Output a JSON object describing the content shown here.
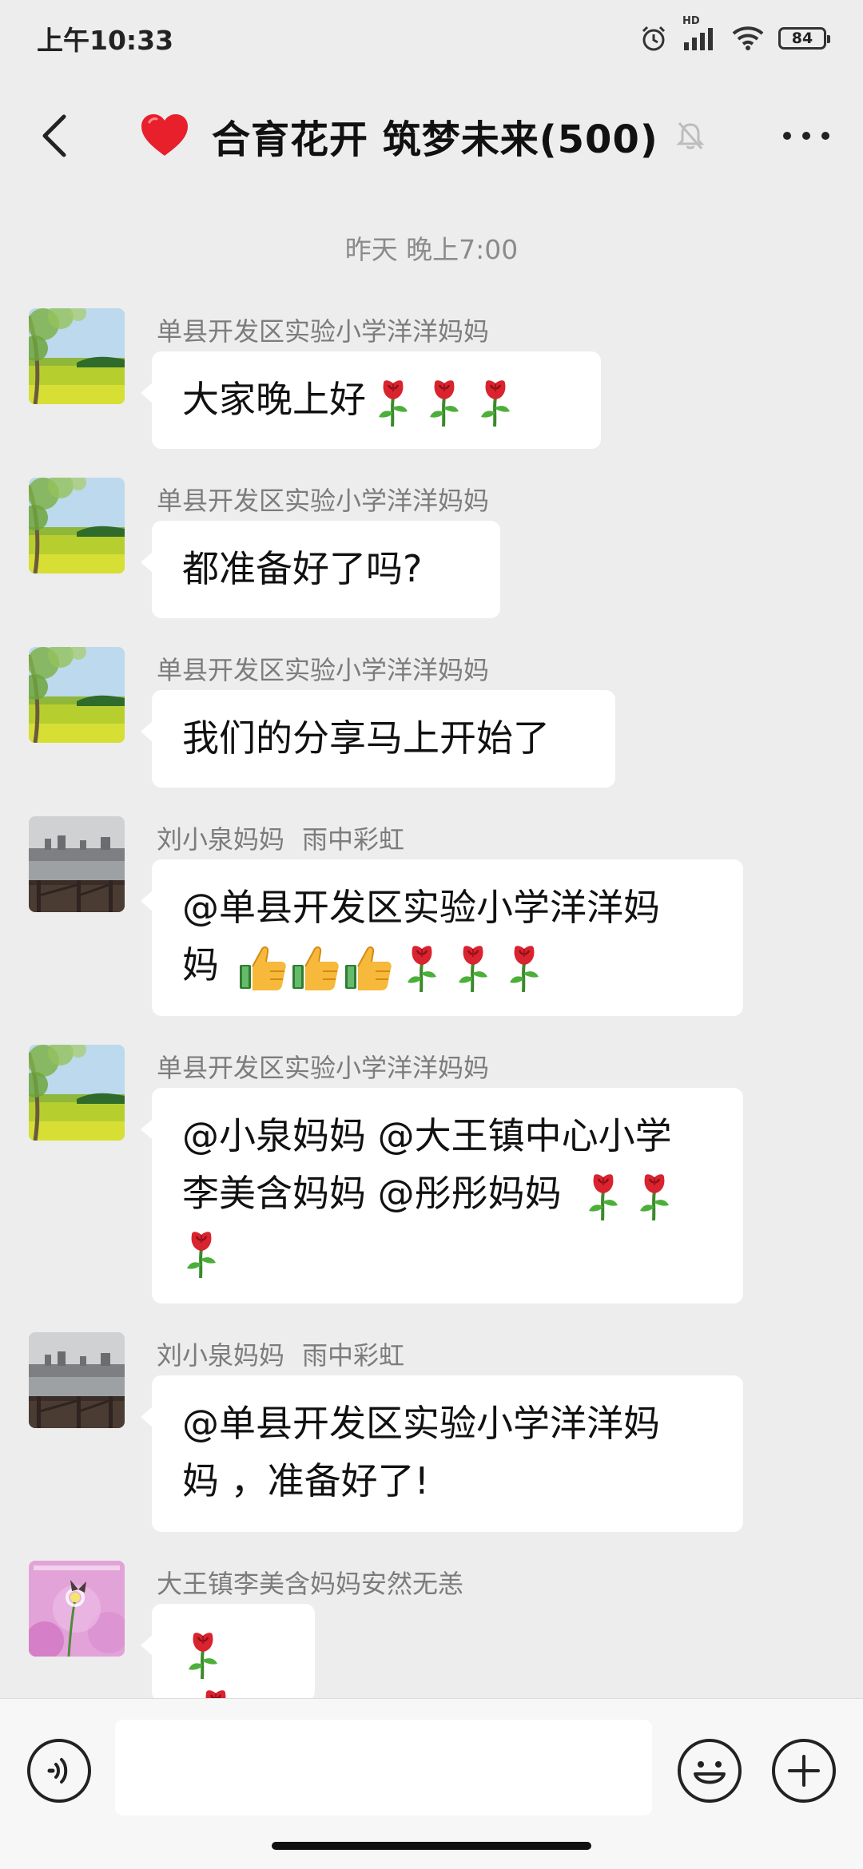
{
  "status_bar": {
    "time": "上午10:33",
    "network_label": "HD",
    "battery": "84"
  },
  "header": {
    "title": "合育花开 筑梦未来(500)",
    "back_icon": "back-chevron-icon",
    "muted_icon": "bell-muted-icon",
    "more_icon": "more-dots-icon"
  },
  "timestamp": "昨天 晚上7:00",
  "messages": [
    {
      "sender": "单县开发区实验小学洋洋妈妈",
      "text": "大家晚上好",
      "emojis": [
        "rose",
        "rose",
        "rose"
      ],
      "avatar": "tree-field-avatar"
    },
    {
      "sender": "单县开发区实验小学洋洋妈妈",
      "text": "都准备好了吗?",
      "avatar": "tree-field-avatar"
    },
    {
      "sender": "单县开发区实验小学洋洋妈妈",
      "text": "我们的分享马上开始了",
      "avatar": "tree-field-avatar"
    },
    {
      "sender": "刘小泉妈妈",
      "sender_nick": "雨中彩虹",
      "line1": "@单县开发区实验小学洋洋妈",
      "line2": "妈",
      "emojis": [
        "thumbs-up",
        "thumbs-up",
        "thumbs-up",
        "rose",
        "rose",
        "rose"
      ],
      "avatar": "lake-avatar"
    },
    {
      "sender": "单县开发区实验小学洋洋妈妈",
      "line1": "@小泉妈妈 @大王镇中心小学",
      "line2": "李美含妈妈 @彤彤妈妈",
      "emojis": [
        "rose",
        "rose",
        "rose"
      ],
      "avatar": "tree-field-avatar"
    },
    {
      "sender": "刘小泉妈妈",
      "sender_nick": "雨中彩虹",
      "line1": "@单县开发区实验小学洋洋妈",
      "line2": "妈 ，准备好了!",
      "avatar": "lake-avatar"
    },
    {
      "sender": "大王镇李美含妈妈安然无恙",
      "emojis": [
        "rose",
        "rose"
      ],
      "avatar": "flower-butterfly-avatar"
    }
  ],
  "input": {
    "value": "",
    "voice_icon": "voice-icon",
    "emoji_icon": "emoji-icon",
    "plus_icon": "plus-icon"
  },
  "colors": {
    "background": "#ededed",
    "bubble": "#ffffff",
    "sender_text": "#7c7c7c",
    "timestamp_text": "#8b8b8b"
  }
}
